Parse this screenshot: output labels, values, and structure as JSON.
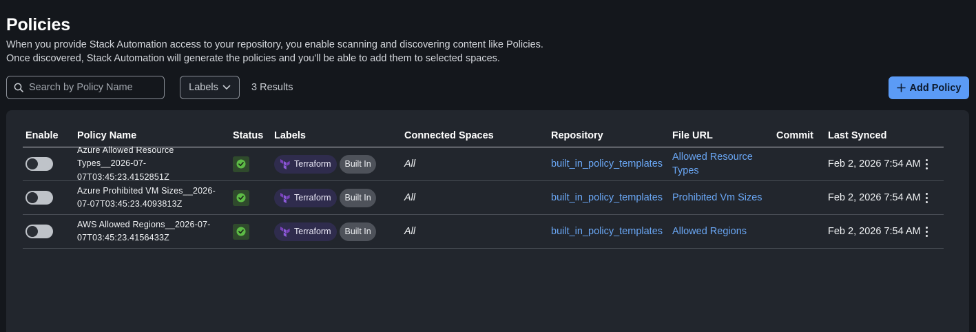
{
  "header": {
    "title": "Policies",
    "description_line1": "When you provide Stack Automation access to your repository, you enable scanning and discovering content like Policies.",
    "description_line2": "Once discovered, Stack Automation will generate the policies and you'll be able to add them to selected spaces."
  },
  "toolbar": {
    "search_placeholder": "Search by Policy Name",
    "search_value": "",
    "labels_button": "Labels",
    "results_count": "3 Results",
    "add_button": "Add Policy"
  },
  "table": {
    "columns": {
      "enable": "Enable",
      "policy_name": "Policy Name",
      "status": "Status",
      "labels": "Labels",
      "connected_spaces": "Connected Spaces",
      "repository": "Repository",
      "file_url": "File URL",
      "commit": "Commit",
      "last_synced": "Last Synced"
    },
    "rows": [
      {
        "enabled": false,
        "name_lines": [
          "Azure Allowed Resource",
          "Types__2026-07-",
          "07T03:45:23.4152851Z"
        ],
        "status": "success",
        "label_terraform": "Terraform",
        "label_builtin": "Built In",
        "connected_spaces": "All",
        "repository": "built_in_policy_templates",
        "file_url_lines": [
          "Allowed Resource",
          "Types"
        ],
        "commit": "",
        "last_synced": "Feb 2, 2026 7:54 AM"
      },
      {
        "enabled": false,
        "name_lines": [
          "Azure Prohibited VM Sizes__2026-",
          "07-07T03:45:23.4093813Z"
        ],
        "status": "success",
        "label_terraform": "Terraform",
        "label_builtin": "Built In",
        "connected_spaces": "All",
        "repository": "built_in_policy_templates",
        "file_url_lines": [
          "Prohibited Vm Sizes"
        ],
        "commit": "",
        "last_synced": "Feb 2, 2026 7:54 AM"
      },
      {
        "enabled": false,
        "name_lines": [
          "AWS Allowed Regions__2026-07-",
          "07T03:45:23.4156433Z"
        ],
        "status": "success",
        "label_terraform": "Terraform",
        "label_builtin": "Built In",
        "connected_spaces": "All",
        "repository": "built_in_policy_templates",
        "file_url_lines": [
          "Allowed Regions"
        ],
        "commit": "",
        "last_synced": "Feb 2, 2026 7:54 AM"
      }
    ]
  },
  "colors": {
    "background": "#14171c",
    "panel": "#22262d",
    "accent": "#5b9bf6",
    "link": "#6aa7f5",
    "success": "#5dbb46",
    "terraform": "#7b42bc"
  },
  "icons": {
    "search": "search-icon",
    "labels_dropdown": "chevron-down-icon",
    "add": "plus-icon",
    "status": "check-circle-icon",
    "terraform": "terraform-logo-icon",
    "row_menu": "kebab-menu-icon"
  }
}
